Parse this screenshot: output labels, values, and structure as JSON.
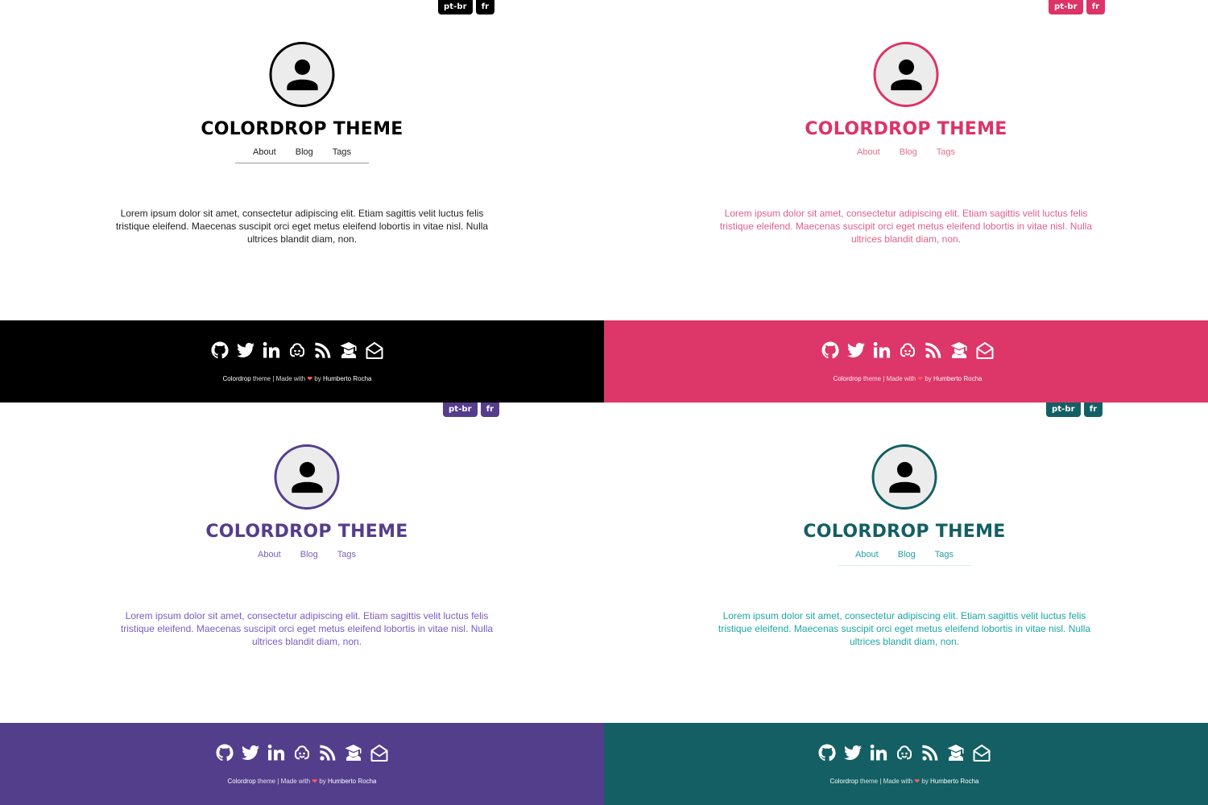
{
  "theme_variants": [
    {
      "variant": "black",
      "accent": "#000000",
      "footer_bg": "#000000",
      "title_color": "#000000",
      "nav_color": "#222222",
      "text_color": "#222222",
      "nav_underline": "#9a9a9a",
      "lang_buttons": [
        "pt-br",
        "fr"
      ],
      "site_title": "COLORDROP THEME",
      "nav": [
        "About",
        "Blog",
        "Tags"
      ],
      "intro": "Lorem ipsum dolor sit amet, consectetur adipiscing elit. Etiam sagittis velit luctus felis tristique eleifend. Maecenas suscipit orci eget metus eleifend lobortis in vitae nisl. Nulla ultrices blandit diam, non.",
      "credits": {
        "brand": "Colordrop",
        "theme_word": "theme",
        "made_with": "Made with",
        "by": "by",
        "author": "Humberto Rocha"
      }
    },
    {
      "variant": "pink",
      "accent": "#dd3366",
      "footer_bg": "#dd3668",
      "title_color": "#dd3366",
      "nav_color": "#e07090",
      "text_color": "#e06088",
      "nav_underline": "transparent",
      "lang_buttons": [
        "pt-br",
        "fr"
      ],
      "site_title": "COLORDROP THEME",
      "nav": [
        "About",
        "Blog",
        "Tags"
      ],
      "intro": "Lorem ipsum dolor sit amet, consectetur adipiscing elit. Etiam sagittis velit luctus felis tristique eleifend. Maecenas suscipit orci eget metus eleifend lobortis in vitae nisl. Nulla ultrices blandit diam, non.",
      "credits": {
        "brand": "Colordrop",
        "theme_word": "theme",
        "made_with": "Made with",
        "by": "by",
        "author": "Humberto Rocha"
      }
    },
    {
      "variant": "purple",
      "accent": "#553d8c",
      "footer_bg": "#533e8c",
      "title_color": "#553d8c",
      "nav_color": "#7a62b8",
      "text_color": "#7a5cc0",
      "nav_underline": "transparent",
      "lang_buttons": [
        "pt-br",
        "fr"
      ],
      "site_title": "COLORDROP THEME",
      "nav": [
        "About",
        "Blog",
        "Tags"
      ],
      "intro": "Lorem ipsum dolor sit amet, consectetur adipiscing elit. Etiam sagittis velit luctus felis tristique eleifend. Maecenas suscipit orci eget metus eleifend lobortis in vitae nisl. Nulla ultrices blandit diam, non.",
      "credits": {
        "brand": "Colordrop",
        "theme_word": "theme",
        "made_with": "Made with",
        "by": "by",
        "author": "Humberto Rocha"
      }
    },
    {
      "variant": "teal",
      "accent": "#135f63",
      "footer_bg": "#135f64",
      "title_color": "#135f63",
      "nav_color": "#22a3a3",
      "text_color": "#1ea6a6",
      "nav_underline": "#d6efef",
      "lang_buttons": [
        "pt-br",
        "fr"
      ],
      "site_title": "COLORDROP THEME",
      "nav": [
        "About",
        "Blog",
        "Tags"
      ],
      "intro": "Lorem ipsum dolor sit amet, consectetur adipiscing elit. Etiam sagittis velit luctus felis tristique eleifend. Maecenas suscipit orci eget metus eleifend lobortis in vitae nisl. Nulla ultrices blandit diam, non.",
      "credits": {
        "brand": "Colordrop",
        "theme_word": "theme",
        "made_with": "Made with",
        "by": "by",
        "author": "Humberto Rocha"
      }
    }
  ],
  "social_icons": [
    "github-icon",
    "twitter-icon",
    "linkedin-icon",
    "gitlab-icon",
    "rss-icon",
    "graduation-cap-icon",
    "envelope-open-icon"
  ],
  "avatar_icon": "user-icon"
}
